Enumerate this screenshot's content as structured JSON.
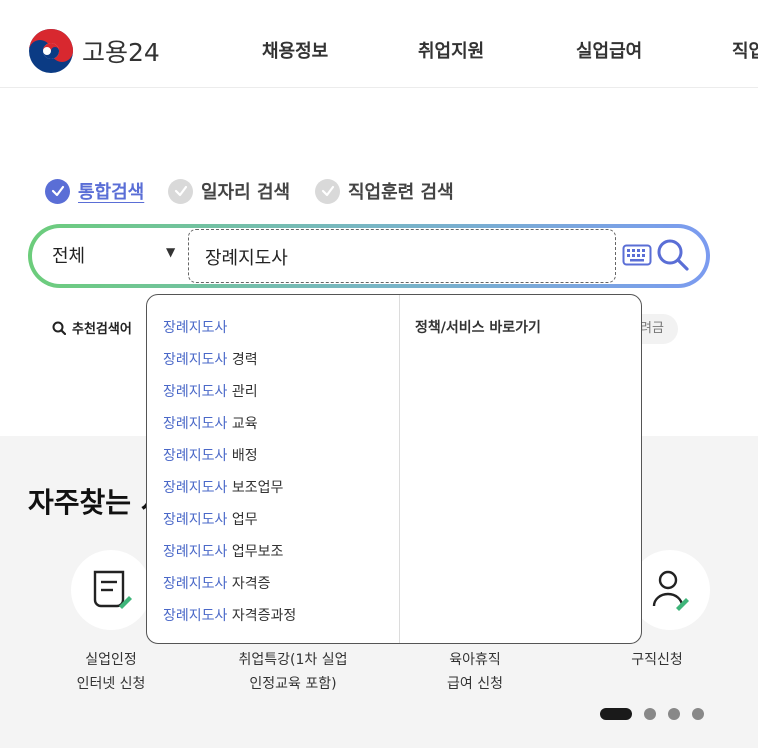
{
  "header": {
    "logo_text": "고용24",
    "nav": [
      "채용정보",
      "취업지원",
      "실업급여",
      "직업"
    ]
  },
  "search": {
    "tabs": [
      {
        "label": "통합검색",
        "active": true
      },
      {
        "label": "일자리 검색",
        "active": false
      },
      {
        "label": "직업훈련 검색",
        "active": false
      }
    ],
    "scope_value": "전체",
    "query": "장례지도사",
    "recommend_label": "추천검색어",
    "chip_peek": "려금"
  },
  "dropdown": {
    "keyword": "장례지도사",
    "suggestions": [
      {
        "hl": "장례지도사",
        "rest": ""
      },
      {
        "hl": "장례지도사",
        "rest": " 경력"
      },
      {
        "hl": "장례지도사",
        "rest": " 관리"
      },
      {
        "hl": "장례지도사",
        "rest": " 교육"
      },
      {
        "hl": "장례지도사",
        "rest": " 배정"
      },
      {
        "hl": "장례지도사",
        "rest": " 보조업무"
      },
      {
        "hl": "장례지도사",
        "rest": " 업무"
      },
      {
        "hl": "장례지도사",
        "rest": " 업무보조"
      },
      {
        "hl": "장례지도사",
        "rest": " 자격증"
      },
      {
        "hl": "장례지도사",
        "rest": " 자격증과정"
      }
    ],
    "right_title": "정책/서비스 바로가기"
  },
  "services": {
    "title": "자주찾는 서",
    "items": [
      {
        "line1": "실업인정",
        "line2": "인터넷 신청",
        "icon": "document-pen-icon"
      },
      {
        "line1": "취업특강(1차 실업",
        "line2": "인정교육 포함)",
        "icon": "lecture-icon"
      },
      {
        "line1": "육아휴직",
        "line2": "급여 신청",
        "icon": "childcare-icon"
      },
      {
        "line1": "구직신청",
        "line2": "",
        "icon": "person-pen-icon"
      }
    ]
  },
  "colors": {
    "accent": "#5a6ed6",
    "highlight": "#4a68c8",
    "gradient_start": "#6ccd7b",
    "gradient_end": "#7b9bf0"
  }
}
